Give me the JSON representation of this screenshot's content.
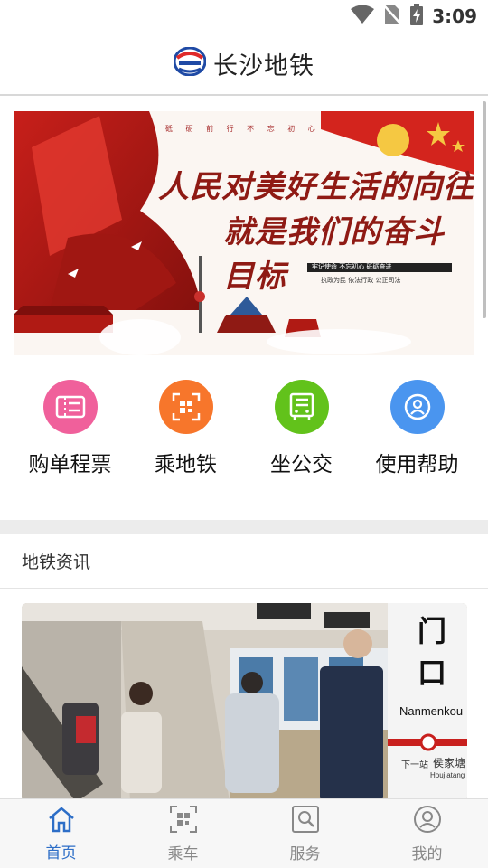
{
  "status_bar": {
    "time": "3:09",
    "icons": [
      "wifi-icon",
      "no-sim-icon",
      "battery-charging-icon"
    ]
  },
  "header": {
    "title": "长沙地铁",
    "logo": "changsha-metro-logo"
  },
  "banner": {
    "slogan_line1": "人民对美好生活的向往",
    "slogan_line2": "就是我们的奋斗目标",
    "small_caption": "砥 砺 前 行   不 忘 初 心",
    "tag_text": "牢记使命 不忘初心 砥砺奋进",
    "tag_sub": "执政为民 依法行政 公正司法",
    "accent": "#c8201e"
  },
  "quick_menu": {
    "items": [
      {
        "label": "购单程票",
        "icon": "ticket-icon",
        "color": "#f0609b"
      },
      {
        "label": "乘地铁",
        "icon": "qr-scan-icon",
        "color": "#f7762b"
      },
      {
        "label": "坐公交",
        "icon": "bus-icon",
        "color": "#62c21b"
      },
      {
        "label": "使用帮助",
        "icon": "help-person-icon",
        "color": "#4a95ef"
      }
    ]
  },
  "news": {
    "section_title": "地铁资讯",
    "photo_sign_name": "门口",
    "photo_sign_pinyin": "Nanmenkou",
    "photo_sign_next": "侯家塘",
    "photo_sign_next_pinyin": "Houjiatang",
    "photo_sign_next_label": "下一站"
  },
  "bottom_nav": {
    "active_color": "#2d6ec7",
    "items": [
      {
        "label": "首页",
        "icon": "home-icon",
        "active": true
      },
      {
        "label": "乘车",
        "icon": "ride-qr-icon",
        "active": false
      },
      {
        "label": "服务",
        "icon": "service-search-icon",
        "active": false
      },
      {
        "label": "我的",
        "icon": "profile-icon",
        "active": false
      }
    ]
  }
}
